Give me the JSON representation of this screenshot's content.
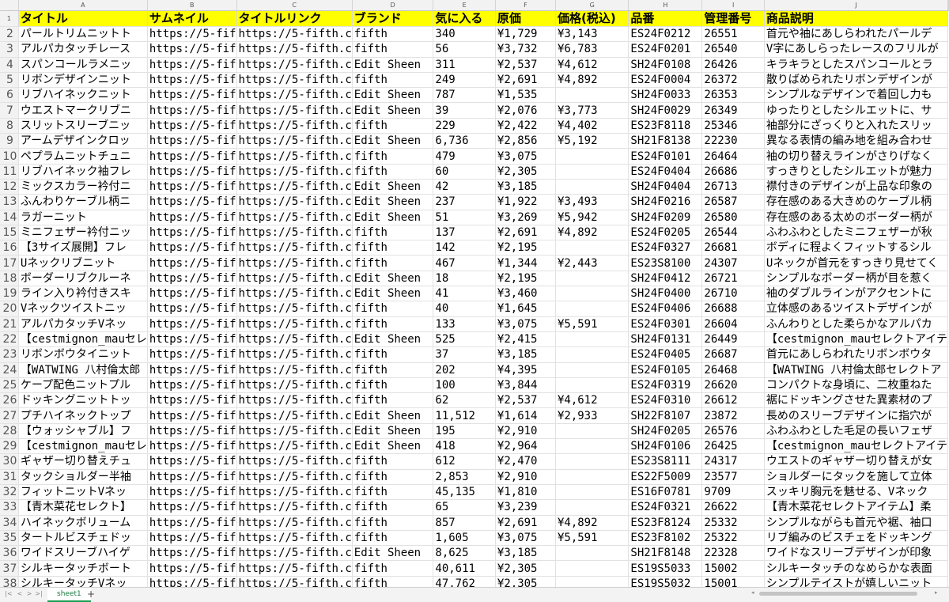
{
  "columns": [
    "A",
    "B",
    "C",
    "D",
    "E",
    "F",
    "G",
    "H",
    "I",
    "J"
  ],
  "headers": [
    "タイトル",
    "サムネイル",
    "タイトルリンク",
    "ブランド",
    "気に入る",
    "原価",
    "価格(税込)",
    "品番",
    "管理番号",
    "商品説明"
  ],
  "rows": [
    [
      "パールトリムニットト",
      "https://5-fif",
      "https://5-fifth.c",
      "fifth",
      "340",
      "¥1,729",
      "¥3,143",
      "ES24F0212",
      "26551",
      "首元や袖にあしらわれたパールデ"
    ],
    [
      "アルパカタッチレース",
      "https://5-fif",
      "https://5-fifth.c",
      "fifth",
      "56",
      "¥3,732",
      "¥6,783",
      "ES24F0201",
      "26540",
      "V字にあしらったレースのフリルが"
    ],
    [
      "スパンコールラメニッ",
      "https://5-fif",
      "https://5-fifth.c",
      "Edit Sheen",
      "311",
      "¥2,537",
      "¥4,612",
      "SH24F0108",
      "26426",
      "キラキラとしたスパンコールとラ"
    ],
    [
      "リボンデザインニット",
      "https://5-fif",
      "https://5-fifth.c",
      "fifth",
      "249",
      "¥2,691",
      "¥4,892",
      "ES24F0004",
      "26372",
      "散りばめられたリボンデザインが"
    ],
    [
      "リブハイネックニット",
      "https://5-fif",
      "https://5-fifth.c",
      "Edit Sheen",
      "787",
      "¥1,535",
      "",
      "SH24F0033",
      "26353",
      "シンプルなデザインで着回し力も"
    ],
    [
      "ウエストマークリブニ",
      "https://5-fif",
      "https://5-fifth.c",
      "Edit Sheen",
      "39",
      "¥2,076",
      "¥3,773",
      "SH24F0029",
      "26349",
      "ゆったりとしたシルエットに、サ"
    ],
    [
      "スリットスリーブニッ",
      "https://5-fif",
      "https://5-fifth.c",
      "fifth",
      "229",
      "¥2,422",
      "¥4,402",
      "ES23F8118",
      "25346",
      "袖部分にざっくりと入れたスリッ"
    ],
    [
      "アームデザインクロッ",
      "https://5-fif",
      "https://5-fifth.c",
      "Edit Sheen",
      "6,736",
      "¥2,856",
      "¥5,192",
      "SH21F8138",
      "22230",
      "異なる表情の編み地を組み合わせ"
    ],
    [
      "ペプラムニットチュニ",
      "https://5-fif",
      "https://5-fifth.c",
      "fifth",
      "479",
      "¥3,075",
      "",
      "ES24F0101",
      "26464",
      "袖の切り替えラインがさりげなく"
    ],
    [
      "リブハイネック袖フレ",
      "https://5-fif",
      "https://5-fifth.c",
      "fifth",
      "60",
      "¥2,305",
      "",
      "ES24F0404",
      "26686",
      "すっきりとしたシルエットが魅力"
    ],
    [
      "ミックスカラー衿付ニ",
      "https://5-fif",
      "https://5-fifth.c",
      "Edit Sheen",
      "42",
      "¥3,185",
      "",
      "SH24F0404",
      "26713",
      "襟付きのデザインが上品な印象の"
    ],
    [
      "ふんわりケーブル柄ニ",
      "https://5-fif",
      "https://5-fifth.c",
      "Edit Sheen",
      "237",
      "¥1,922",
      "¥3,493",
      "SH24F0216",
      "26587",
      "存在感のある大きめのケーブル柄"
    ],
    [
      "ラガーニット",
      "https://5-fif",
      "https://5-fifth.c",
      "Edit Sheen",
      "51",
      "¥3,269",
      "¥5,942",
      "SH24F0209",
      "26580",
      "存在感のある太めのボーダー柄が"
    ],
    [
      "ミニフェザー衿付ニッ",
      "https://5-fif",
      "https://5-fifth.c",
      "fifth",
      "137",
      "¥2,691",
      "¥4,892",
      "ES24F0205",
      "26544",
      "ふわふわとしたミニフェザーが秋"
    ],
    [
      "【3サイズ展開】フレ",
      "https://5-fif",
      "https://5-fifth.c",
      "fifth",
      "142",
      "¥2,195",
      "",
      "ES24F0327",
      "26681",
      "ボディに程よくフィットするシル"
    ],
    [
      "Uネックリブニット",
      "https://5-fif",
      "https://5-fifth.c",
      "fifth",
      "467",
      "¥1,344",
      "¥2,443",
      "ES23S8100",
      "24307",
      "Uネックが首元をすっきり見せてく"
    ],
    [
      "ボーダーリブクルーネ",
      "https://5-fif",
      "https://5-fifth.c",
      "Edit Sheen",
      "18",
      "¥2,195",
      "",
      "SH24F0412",
      "26721",
      "シンプルなボーダー柄が目を惹く"
    ],
    [
      "ライン入り衿付きスキ",
      "https://5-fif",
      "https://5-fifth.c",
      "Edit Sheen",
      "41",
      "¥3,460",
      "",
      "SH24F0400",
      "26710",
      "袖のダブルラインがアクセントに"
    ],
    [
      "Vネックツイストニッ",
      "https://5-fif",
      "https://5-fifth.c",
      "fifth",
      "40",
      "¥1,645",
      "",
      "ES24F0406",
      "26688",
      "立体感のあるツイストデザインが"
    ],
    [
      "アルパカタッチVネッ",
      "https://5-fif",
      "https://5-fifth.c",
      "fifth",
      "133",
      "¥3,075",
      "¥5,591",
      "ES24F0301",
      "26604",
      "ふんわりとした柔らかなアルパカ"
    ],
    [
      "【cestmignon_mauセレ",
      "https://5-fif",
      "https://5-fifth.c",
      "Edit Sheen",
      "525",
      "¥2,415",
      "",
      "SH24F0131",
      "26449",
      "【cestmignon_mauセレクトアイテ"
    ],
    [
      "リボンボウタイニット",
      "https://5-fif",
      "https://5-fifth.c",
      "fifth",
      "37",
      "¥3,185",
      "",
      "ES24F0405",
      "26687",
      "首元にあしらわれたリボンボウタ"
    ],
    [
      "【WATWING 八村倫太郎",
      "https://5-fif",
      "https://5-fifth.c",
      "fifth",
      "202",
      "¥4,395",
      "",
      "ES24F0105",
      "26468",
      "【WATWING 八村倫太郎セレクトア"
    ],
    [
      "ケープ配色ニットプル",
      "https://5-fif",
      "https://5-fifth.c",
      "fifth",
      "100",
      "¥3,844",
      "",
      "ES24F0319",
      "26620",
      "コンパクトな身頃に、二枚重ねた"
    ],
    [
      "ドッキングニットトッ",
      "https://5-fif",
      "https://5-fifth.c",
      "fifth",
      "62",
      "¥2,537",
      "¥4,612",
      "ES24F0310",
      "26612",
      "裾にドッキングさせた異素材のプ"
    ],
    [
      "プチハイネックトップ",
      "https://5-fif",
      "https://5-fifth.c",
      "Edit Sheen",
      "11,512",
      "¥1,614",
      "¥2,933",
      "SH22F8107",
      "23872",
      "長めのスリーブデザインに指穴が"
    ],
    [
      "【ウォッシャブル】フ",
      "https://5-fif",
      "https://5-fifth.c",
      "Edit Sheen",
      "195",
      "¥2,910",
      "",
      "SH24F0205",
      "26576",
      "ふわふわとした毛足の長いフェザ"
    ],
    [
      "【cestmignon_mauセレ",
      "https://5-fif",
      "https://5-fifth.c",
      "Edit Sheen",
      "418",
      "¥2,964",
      "",
      "SH24F0106",
      "26425",
      "【cestmignon_mauセレクトアイテ"
    ],
    [
      "ギャザー切り替えチュ",
      "https://5-fif",
      "https://5-fifth.c",
      "fifth",
      "612",
      "¥2,470",
      "",
      "ES23S8111",
      "24317",
      "ウエストのギャザー切り替えが女"
    ],
    [
      "タックショルダー半袖",
      "https://5-fif",
      "https://5-fifth.c",
      "fifth",
      "2,853",
      "¥2,910",
      "",
      "ES22F5009",
      "23577",
      "ショルダーにタックを施して立体"
    ],
    [
      "フィットニットVネッ",
      "https://5-fif",
      "https://5-fifth.c",
      "fifth",
      "45,135",
      "¥1,810",
      "",
      "ES16F0781",
      "9709",
      "スッキリ胸元を魅せる、Vネック"
    ],
    [
      "【青木菜花セレクト】",
      "https://5-fif",
      "https://5-fifth.c",
      "fifth",
      "65",
      "¥3,239",
      "",
      "ES24F0321",
      "26622",
      "【青木菜花セレクトアイテム】柔"
    ],
    [
      "ハイネックボリューム",
      "https://5-fif",
      "https://5-fifth.c",
      "fifth",
      "857",
      "¥2,691",
      "¥4,892",
      "ES23F8124",
      "25332",
      "シンプルながらも首元や裾、袖口"
    ],
    [
      "タートルビスチェドッ",
      "https://5-fif",
      "https://5-fifth.c",
      "fifth",
      "1,605",
      "¥3,075",
      "¥5,591",
      "ES23F8102",
      "25322",
      "リブ編みのビスチェをドッキング"
    ],
    [
      "ワイドスリーブハイゲ",
      "https://5-fif",
      "https://5-fifth.c",
      "Edit Sheen",
      "8,625",
      "¥3,185",
      "",
      "SH21F8148",
      "22328",
      "ワイドなスリーブデザインが印象"
    ],
    [
      "シルキータッチボート",
      "https://5-fif",
      "https://5-fifth.c",
      "fifth",
      "40,611",
      "¥2,305",
      "",
      "ES19S5033",
      "15002",
      "シルキータッチのなめらかな表面"
    ],
    [
      "シルキータッチVネッ",
      "https://5-fif",
      "https://5-fifth.c",
      "fifth",
      "47,762",
      "¥2,305",
      "",
      "ES19S5032",
      "15001",
      "シンプルテイストが嬉しいニット"
    ]
  ],
  "footer": {
    "sheet_tab": "sheet1",
    "add_sheet": "+",
    "nav": [
      "|<",
      "<",
      ">",
      ">|"
    ],
    "scroll_arrows": [
      "◂",
      "▸"
    ]
  },
  "colors": {
    "header_fill": "#ffff00",
    "tab_accent": "#1a9e52"
  }
}
